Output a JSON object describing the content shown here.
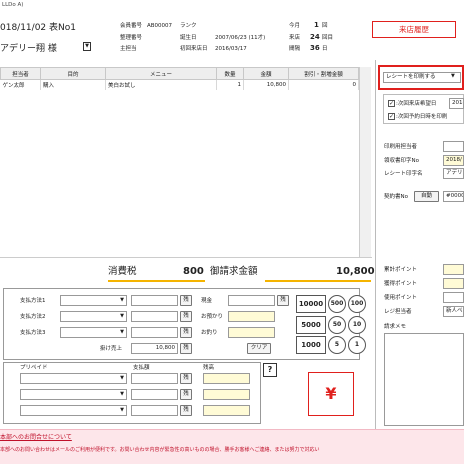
{
  "header": {
    "title_fragment": "LLDo A)",
    "date_line": "018/11/02  表No1",
    "customer_name": "アデリー翔 様",
    "member_no_label": "会員番号",
    "member_no_value": "AB00007",
    "rank_label": "ランク",
    "management_no_label": "整理番号",
    "birthday_label": "誕生日",
    "birthday_value": "2007/06/23 (11才)",
    "staff_label": "主担当",
    "first_visit_label": "初回来店日",
    "first_visit_value": "2016/03/17",
    "month_label": "今月",
    "month_value": "1",
    "month_unit": "回",
    "visits_label": "来店",
    "visits_value": "24",
    "visits_unit": "回目",
    "interval_label": "間隔",
    "interval_value": "36",
    "interval_unit": "日",
    "history_button": "来店履歴"
  },
  "table": {
    "columns": [
      "担当者",
      "目的",
      "メニュー",
      "数量",
      "金額",
      "割引・割増金額"
    ],
    "rows": [
      {
        "staff": "ゲン太郎",
        "purpose": "購入",
        "menu": "美白お試し",
        "qty": "1",
        "amount": "10,800",
        "discount": "0"
      }
    ]
  },
  "totals": {
    "tax_label": "消費税",
    "tax_value": "800",
    "bill_label": "御請求金額",
    "bill_value": "10,800"
  },
  "payment": {
    "methods": [
      "支払方法1",
      "支払方法2",
      "支払方法3"
    ],
    "short_label": "残",
    "cash_label": "現金",
    "deposit_label": "お預かり",
    "change_label": "お釣り",
    "credit_label": "掛け売上",
    "credit_value": "10,800",
    "clear_button": "クリア",
    "prepaid_label": "プリペイド",
    "paid_amount_label": "支払額",
    "balance_label": "残高",
    "help_button": "?",
    "yen_button": "¥",
    "money_buttons": [
      "10000",
      "5000",
      "1000",
      "500",
      "100",
      "50",
      "10",
      "5",
      "1"
    ]
  },
  "right_panel": {
    "receipt_select": "レシートを印刷する",
    "next_visit_label": ":次回来店希望日",
    "next_visit_value": "2018",
    "next_reserve_label": ":次回予約日時を印刷",
    "print_staff_label": "印刷用担当者",
    "receipt_date_label": "領収書印字No",
    "receipt_date_value": "2018/",
    "receipt_name_label": "レシート印字名",
    "receipt_name_value": "アデリー",
    "contract_label": "契約書No",
    "auto_button": "自動",
    "contract_value": "#0000",
    "points_total_label": "累計ポイント",
    "points_add_label": "獲得ポイント",
    "points_use_label": "使用ポイント",
    "register_staff_label": "レジ担当者",
    "register_staff_value": "新人ペ",
    "memo_label": "請求メモ"
  },
  "footer": {
    "link": "本部へのお問合せについて",
    "notice": "本部へのお問い合わせはメールのご利用が便利です。お問い合わせ内容が緊急性の高いものの場合、勝手お客様へご連絡、または努力で対応い"
  },
  "colors": {
    "accent_red": "#e0201d",
    "yellow_bar": "#f5b400",
    "yellow_input": "#fffbd6",
    "footer_pink": "#fde6ea"
  }
}
